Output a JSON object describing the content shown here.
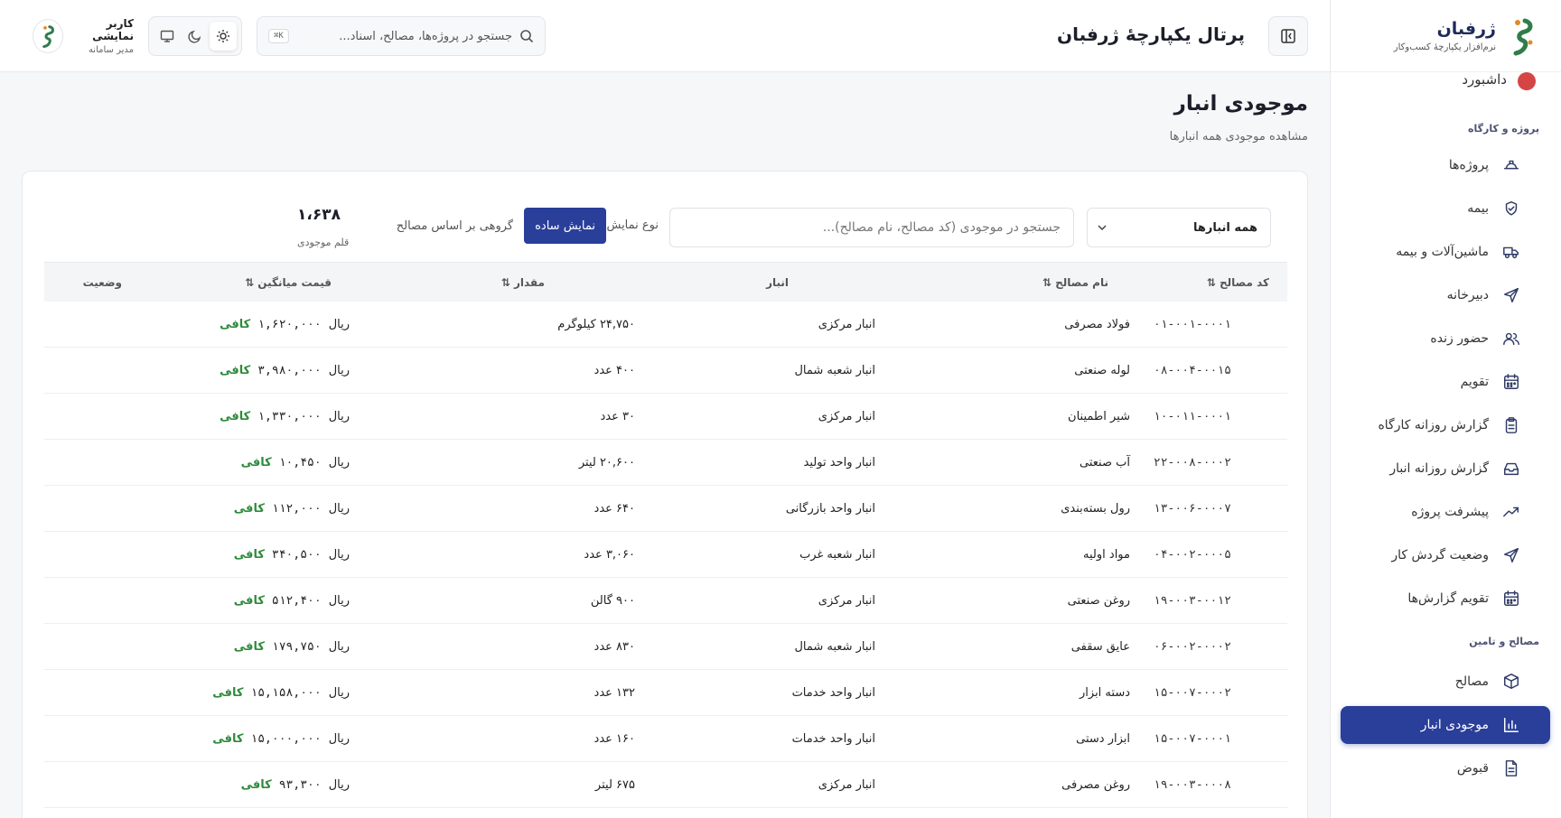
{
  "brand": {
    "name": "ژرفبان",
    "subtitle": "نرم‌افزار یکپارچهٔ کسب‌وکار"
  },
  "header": {
    "portal_title": "پرتال یکپارچهٔ ژرفبان",
    "search_placeholder": "جستجو در پروژه‌ها، مصالح، اسناد...",
    "shortcut": "K⌘",
    "user_name": "کاربر نمایشی",
    "user_role": "مدیر سامانه"
  },
  "sidebar": {
    "partial_item": "داشبورد",
    "section_projects": "پروژه و کارگاه",
    "section_materials": "مصالح و تامین",
    "items": [
      {
        "label": "پروژه‌ها",
        "icon": "helmet-icon"
      },
      {
        "label": "بیمه",
        "icon": "shield-icon"
      },
      {
        "label": "ماشین‌آلات و بیمه",
        "icon": "truck-icon"
      },
      {
        "label": "دبیرخانه",
        "icon": "send-icon"
      },
      {
        "label": "حضور زنده",
        "icon": "users-icon"
      },
      {
        "label": "تقویم",
        "icon": "calendar-icon"
      },
      {
        "label": "گزارش روزانه کارگاه",
        "icon": "clipboard-icon"
      },
      {
        "label": "گزارش روزانه انبار",
        "icon": "inbox-icon"
      },
      {
        "label": "پیشرفت پروژه",
        "icon": "trend-icon"
      },
      {
        "label": "وضعیت گردش کار",
        "icon": "send-icon"
      },
      {
        "label": "تقویم گزارش‌ها",
        "icon": "calendar-icon"
      },
      {
        "label": "مصالح",
        "icon": "box-icon"
      },
      {
        "label": "موجودی انبار",
        "icon": "bar-chart-icon"
      },
      {
        "label": "قبوض",
        "icon": "file-icon"
      }
    ]
  },
  "page": {
    "title": "موجودی انبار",
    "subtitle": "مشاهده موجودی همه انبارها"
  },
  "filters": {
    "warehouse_select": "همه انبارها",
    "search_placeholder": "جستجو در موجودی (کد مصالح، نام مصالح)...",
    "view_label": "نوع نمایش:",
    "view_simple": "نمایش ساده",
    "view_grouped": "گروهی بر اساس مصالح",
    "count_value": "۱،۶۳۸",
    "count_label": "قلم موجودی"
  },
  "table": {
    "headers": {
      "code": "کد مصالح",
      "name": "نام مصالح",
      "warehouse": "انبار",
      "quantity": "مقدار",
      "price": "قیمت میانگین",
      "status": "وضعیت"
    },
    "currency": "ریال",
    "rows": [
      {
        "code": "۰۱-۰۰۱-۰۰۰۱",
        "name": "فولاد مصرفی",
        "warehouse": "انبار مرکزی",
        "quantity": "۲۴,۷۵۰ کیلوگرم",
        "price": "۱,۶۲۰,۰۰۰",
        "status": "کافی"
      },
      {
        "code": "۰۸-۰۰۴-۰۰۱۵",
        "name": "لوله صنعتی",
        "warehouse": "انبار شعبه شمال",
        "quantity": "۴۰۰ عدد",
        "price": "۳,۹۸۰,۰۰۰",
        "status": "کافی"
      },
      {
        "code": "۱۰-۰۱۱-۰۰۰۱",
        "name": "شیر اطمینان",
        "warehouse": "انبار مرکزی",
        "quantity": "۳۰ عدد",
        "price": "۱,۳۳۰,۰۰۰",
        "status": "کافی"
      },
      {
        "code": "۲۲-۰۰۸-۰۰۰۲",
        "name": "آب صنعتی",
        "warehouse": "انبار واحد تولید",
        "quantity": "۲۰,۶۰۰ لیتر",
        "price": "۱۰,۴۵۰",
        "status": "کافی"
      },
      {
        "code": "۱۳-۰۰۶-۰۰۰۷",
        "name": "رول بسته‌بندی",
        "warehouse": "انبار واحد بازرگانی",
        "quantity": "۶۴۰ عدد",
        "price": "۱۱۲,۰۰۰",
        "status": "کافی"
      },
      {
        "code": "۰۴-۰۰۲-۰۰۰۵",
        "name": "مواد اولیه",
        "warehouse": "انبار شعبه غرب",
        "quantity": "۳,۰۶۰ عدد",
        "price": "۳۴۰,۵۰۰",
        "status": "کافی"
      },
      {
        "code": "۱۹-۰۰۳-۰۰۱۲",
        "name": "روغن صنعتی",
        "warehouse": "انبار مرکزی",
        "quantity": "۹۰۰ گالن",
        "price": "۵۱۲,۴۰۰",
        "status": "کافی"
      },
      {
        "code": "۰۶-۰۰۲-۰۰۰۲",
        "name": "عایق سقفی",
        "warehouse": "انبار شعبه شمال",
        "quantity": "۸۳۰ عدد",
        "price": "۱۷۹,۷۵۰",
        "status": "کافی"
      },
      {
        "code": "۱۵-۰۰۷-۰۰۰۲",
        "name": "دسته ابزار",
        "warehouse": "انبار واحد خدمات",
        "quantity": "۱۳۲ عدد",
        "price": "۱۵,۱۵۸,۰۰۰",
        "status": "کافی"
      },
      {
        "code": "۱۵-۰۰۷-۰۰۰۱",
        "name": "ابزار دستی",
        "warehouse": "انبار واحد خدمات",
        "quantity": "۱۶۰ عدد",
        "price": "۱۵,۰۰۰,۰۰۰",
        "status": "کافی"
      },
      {
        "code": "۱۹-۰۰۳-۰۰۰۸",
        "name": "روغن مصرفی",
        "warehouse": "انبار مرکزی",
        "quantity": "۶۷۵ لیتر",
        "price": "۹۳,۳۰۰",
        "status": "کافی"
      }
    ]
  },
  "colors": {
    "primary": "#2a3f9a",
    "success": "#2e8b3c",
    "logo_green": "#2f7d4a",
    "logo_orange": "#e08a2c"
  }
}
